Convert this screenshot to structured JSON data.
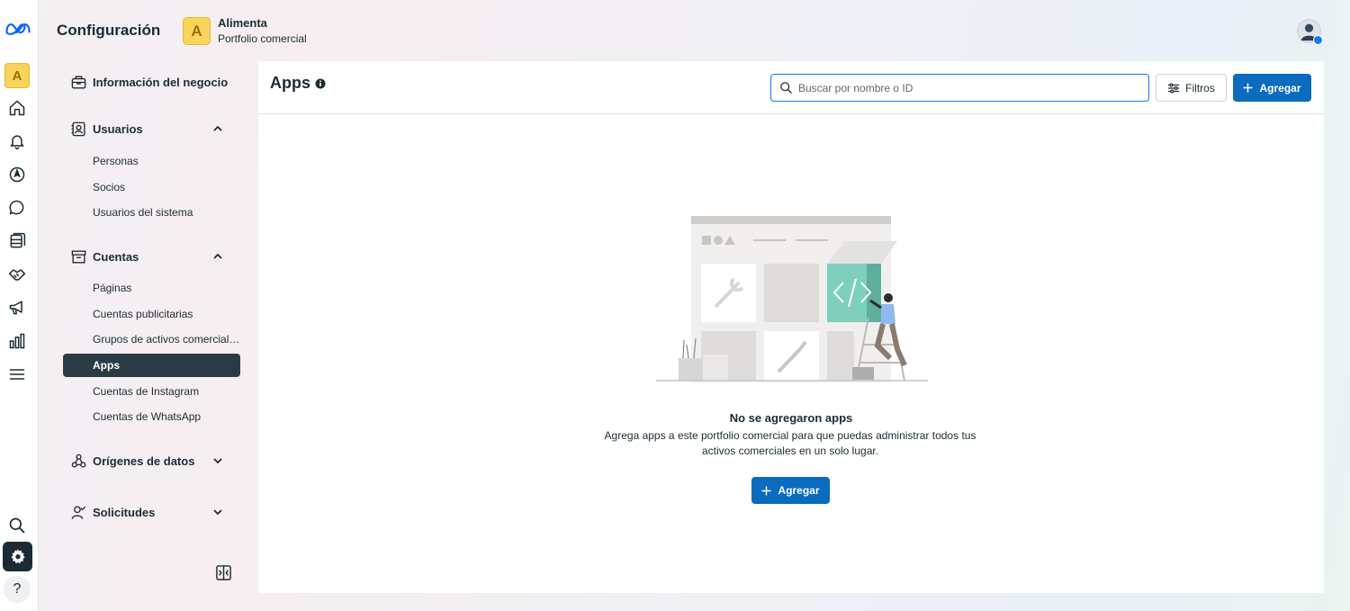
{
  "header": {
    "title": "Configuración",
    "business_initial": "A",
    "business_name": "Alimenta",
    "business_subtitle": "Portfolio comercial"
  },
  "rail": {
    "account_initial": "A",
    "icons": [
      "meta-logo-icon",
      "home-icon",
      "bell-icon",
      "compass-icon",
      "chat-icon",
      "pages-icon",
      "handshake-icon",
      "megaphone-icon",
      "bar-chart-icon",
      "menu-icon",
      "search-icon",
      "gear-icon",
      "help-icon"
    ],
    "help_glyph": "?"
  },
  "sidebar": {
    "business_info": "Información del negocio",
    "users": {
      "label": "Usuarios",
      "items": [
        "Personas",
        "Socios",
        "Usuarios del sistema"
      ]
    },
    "accounts": {
      "label": "Cuentas",
      "items": [
        "Páginas",
        "Cuentas publicitarias",
        "Grupos de activos comerciales",
        "Apps",
        "Cuentas de Instagram",
        "Cuentas de WhatsApp"
      ],
      "active": "Apps"
    },
    "data_sources": "Orígenes de datos",
    "requests": "Solicitudes"
  },
  "main": {
    "title": "Apps",
    "search_placeholder": "Buscar por nombre o ID",
    "filters_label": "Filtros",
    "add_label": "Agregar",
    "empty_title": "No se agregaron apps",
    "empty_description": "Agrega apps a este portfolio comercial para que puedas administrar todos tus activos comerciales en un solo lugar.",
    "empty_add_label": "Agregar"
  },
  "colors": {
    "primary": "#0a6bbf",
    "active_nav": "#2b3b45",
    "brand_yellow": "#f7d45a",
    "accent_teal": "#7fcfbd"
  }
}
